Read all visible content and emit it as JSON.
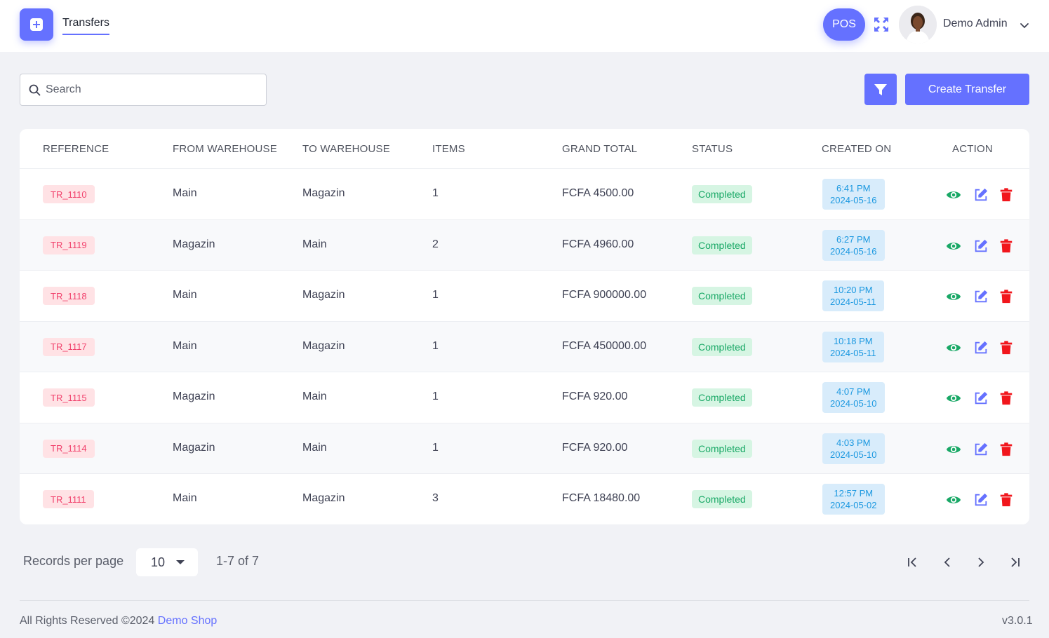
{
  "header": {
    "page_title": "Transfers",
    "pos_label": "POS",
    "user_name": "Demo Admin"
  },
  "toolbar": {
    "search_placeholder": "Search",
    "create_label": "Create Transfer"
  },
  "table": {
    "columns": [
      "REFERENCE",
      "FROM WAREHOUSE",
      "TO WAREHOUSE",
      "ITEMS",
      "GRAND TOTAL",
      "STATUS",
      "CREATED ON",
      "ACTION"
    ],
    "rows": [
      {
        "reference": "TR_1110",
        "from": "Main",
        "to": "Magazin",
        "items": "1",
        "total": "FCFA 4500.00",
        "status": "Completed",
        "time": "6:41 PM",
        "date": "2024-05-16"
      },
      {
        "reference": "TR_1119",
        "from": "Magazin",
        "to": "Main",
        "items": "2",
        "total": "FCFA 4960.00",
        "status": "Completed",
        "time": "6:27 PM",
        "date": "2024-05-16"
      },
      {
        "reference": "TR_1118",
        "from": "Main",
        "to": "Magazin",
        "items": "1",
        "total": "FCFA 900000.00",
        "status": "Completed",
        "time": "10:20 PM",
        "date": "2024-05-11"
      },
      {
        "reference": "TR_1117",
        "from": "Main",
        "to": "Magazin",
        "items": "1",
        "total": "FCFA 450000.00",
        "status": "Completed",
        "time": "10:18 PM",
        "date": "2024-05-11"
      },
      {
        "reference": "TR_1115",
        "from": "Magazin",
        "to": "Main",
        "items": "1",
        "total": "FCFA 920.00",
        "status": "Completed",
        "time": "4:07 PM",
        "date": "2024-05-10"
      },
      {
        "reference": "TR_1114",
        "from": "Magazin",
        "to": "Main",
        "items": "1",
        "total": "FCFA 920.00",
        "status": "Completed",
        "time": "4:03 PM",
        "date": "2024-05-10"
      },
      {
        "reference": "TR_1111",
        "from": "Main",
        "to": "Magazin",
        "items": "3",
        "total": "FCFA 18480.00",
        "status": "Completed",
        "time": "12:57 PM",
        "date": "2024-05-02"
      }
    ]
  },
  "pagination": {
    "records_label": "Records per page",
    "per_page": "10",
    "range": "1-7 of 7"
  },
  "footer": {
    "copyright_prefix": "All Rights Reserved ©2024 ",
    "shop_name": "Demo Shop",
    "version": "v3.0.1"
  },
  "icons": {
    "menu": "plus-square-icon",
    "fullscreen": "fullscreen-icon",
    "search": "search-icon",
    "filter": "filter-icon",
    "view": "eye-icon",
    "edit": "edit-icon",
    "delete": "trash-icon"
  },
  "colors": {
    "primary": "#6571ff",
    "success": "#19a866",
    "danger": "#f1416c",
    "info": "#1b98e0"
  }
}
